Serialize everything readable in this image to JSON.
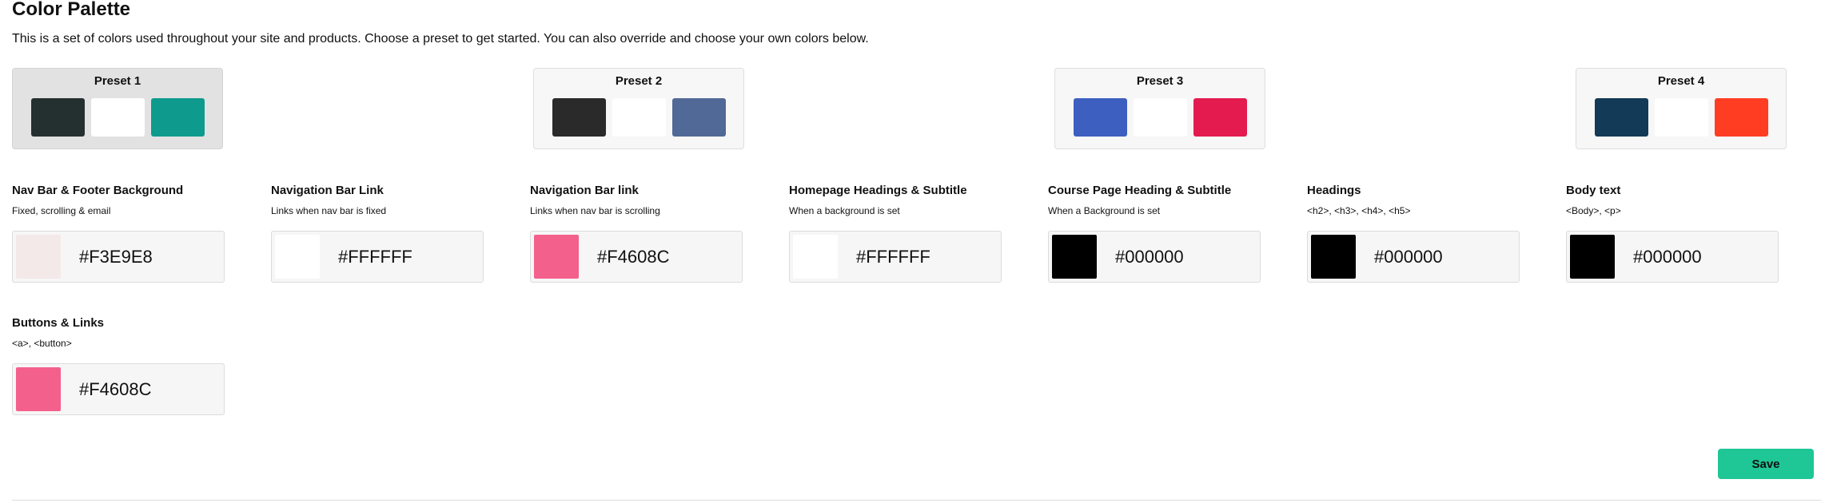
{
  "header": {
    "title": "Color Palette",
    "description": "This is a set of colors used throughout your site and products. Choose a preset to get started. You can also override and choose your own colors below."
  },
  "presets": [
    {
      "label": "Preset 1",
      "selected": true,
      "colors": [
        "#243030",
        "#FFFFFF",
        "#0E9B8E"
      ]
    },
    {
      "label": "Preset 2",
      "selected": false,
      "colors": [
        "#2A2A2A",
        "#FFFFFF",
        "#506996"
      ]
    },
    {
      "label": "Preset 3",
      "selected": false,
      "colors": [
        "#3D5FC0",
        "#FFFFFF",
        "#E31B4E"
      ]
    },
    {
      "label": "Preset 4",
      "selected": false,
      "colors": [
        "#133A56",
        "#FFFFFF",
        "#FF3D23"
      ]
    }
  ],
  "fields": [
    {
      "label": "Nav Bar & Footer Background",
      "help": "Fixed, scrolling & email",
      "hex": "#F3E9E8"
    },
    {
      "label": "Navigation Bar Link",
      "help": "Links when nav bar is fixed",
      "hex": "#FFFFFF"
    },
    {
      "label": "Navigation Bar link",
      "help": "Links when nav bar is scrolling",
      "hex": "#F4608C"
    },
    {
      "label": "Homepage Headings & Subtitle",
      "help": "When a background is set",
      "hex": "#FFFFFF"
    },
    {
      "label": "Course Page Heading & Subtitle",
      "help": "When a Background is set",
      "hex": "#000000"
    },
    {
      "label": "Headings",
      "help": "<h2>, <h3>, <h4>, <h5>",
      "hex": "#000000"
    },
    {
      "label": "Body text",
      "help": "<Body>, <p>",
      "hex": "#000000"
    },
    {
      "label": "Buttons & Links",
      "help": "<a>, <button>",
      "hex": "#F4608C"
    }
  ],
  "actions": {
    "save_label": "Save"
  }
}
